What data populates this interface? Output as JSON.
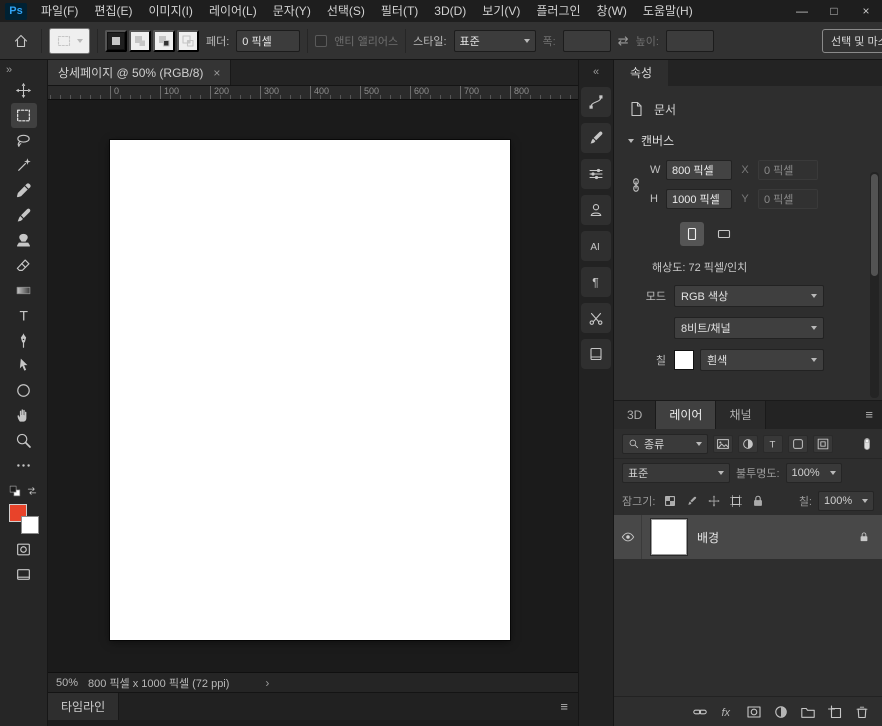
{
  "colors": {
    "foreground_swatch": "#e8432a",
    "background_swatch": "#ffffff",
    "logo_blue": "#2fa3f5",
    "selected_layer_bg": "#484848"
  },
  "glyphs": {
    "panel_collapse": "«",
    "toolbar_expand": "»",
    "panel_menu": "≡",
    "status_chevron": "›",
    "swap": "⇄"
  },
  "menubar": {
    "logo": "Ps",
    "items": [
      "파일(F)",
      "편집(E)",
      "이미지(I)",
      "레이어(L)",
      "문자(Y)",
      "선택(S)",
      "필터(T)",
      "3D(D)",
      "보기(V)",
      "플러그인",
      "창(W)",
      "도움말(H)"
    ],
    "window_controls": {
      "minimize": "—",
      "maximize": "□",
      "close": "×"
    }
  },
  "options": {
    "feather_label": "페더:",
    "feather_value": "0 픽셀",
    "antialias_label": "앤티 앨리어스",
    "style_label": "스타일:",
    "style_value": "표준",
    "width_label": "폭:",
    "width_value": "",
    "height_label": "높이:",
    "height_value": "",
    "select_mask_button": "선택 및 마스크..."
  },
  "toolbar_icons": [
    "move",
    "rectangular-marquee",
    "lasso",
    "magic-wand",
    "eyedropper",
    "brush",
    "clone-stamp",
    "eraser",
    "gradient",
    "type",
    "pen",
    "path-selection",
    "ellipse-shape",
    "hand",
    "zoom",
    "more-tools",
    "default-colors",
    "swap-colors",
    "quick-mask",
    "screen-mode"
  ],
  "panelstrip_icons": [
    "shape-properties",
    "brush-settings",
    "adjustments",
    "libraries",
    "character",
    "paragraph",
    "tools",
    "export"
  ],
  "document": {
    "tab_title": "상세페이지 @ 50% (RGB/8)",
    "tab_close": "×",
    "ruler_labels": [
      "0",
      "100",
      "200",
      "300",
      "400",
      "500",
      "600",
      "700",
      "800"
    ],
    "zoom_level": "50%",
    "status_info": "800 픽셀 x 1000 픽셀 (72 ppi)",
    "timeline_tab": "타임라인"
  },
  "properties": {
    "tab": "속성",
    "document_label": "문서",
    "canvas_section": "캔버스",
    "w_label": "W",
    "w_value": "800 픽셀",
    "x_label": "X",
    "x_value": "0 픽셀",
    "h_label": "H",
    "h_value": "1000 픽셀",
    "y_label": "Y",
    "y_value": "0 픽셀",
    "resolution": "해상도: 72 픽셀/인치",
    "mode_label": "모드",
    "mode_value": "RGB 색상",
    "depth_value": "8비트/채널",
    "fill_label": "칠",
    "fill_value": "흰색"
  },
  "layers_panel": {
    "tabs": [
      "3D",
      "레이어",
      "채널"
    ],
    "active_tab": "레이어",
    "filter_value": "종류",
    "blend_value": "표준",
    "opacity_label": "불투명도:",
    "opacity_value": "100%",
    "lock_label": "잠그기:",
    "fill_label": "칠:",
    "fill_value": "100%",
    "layers": [
      {
        "name": "배경",
        "locked": true,
        "visible": true
      }
    ]
  }
}
